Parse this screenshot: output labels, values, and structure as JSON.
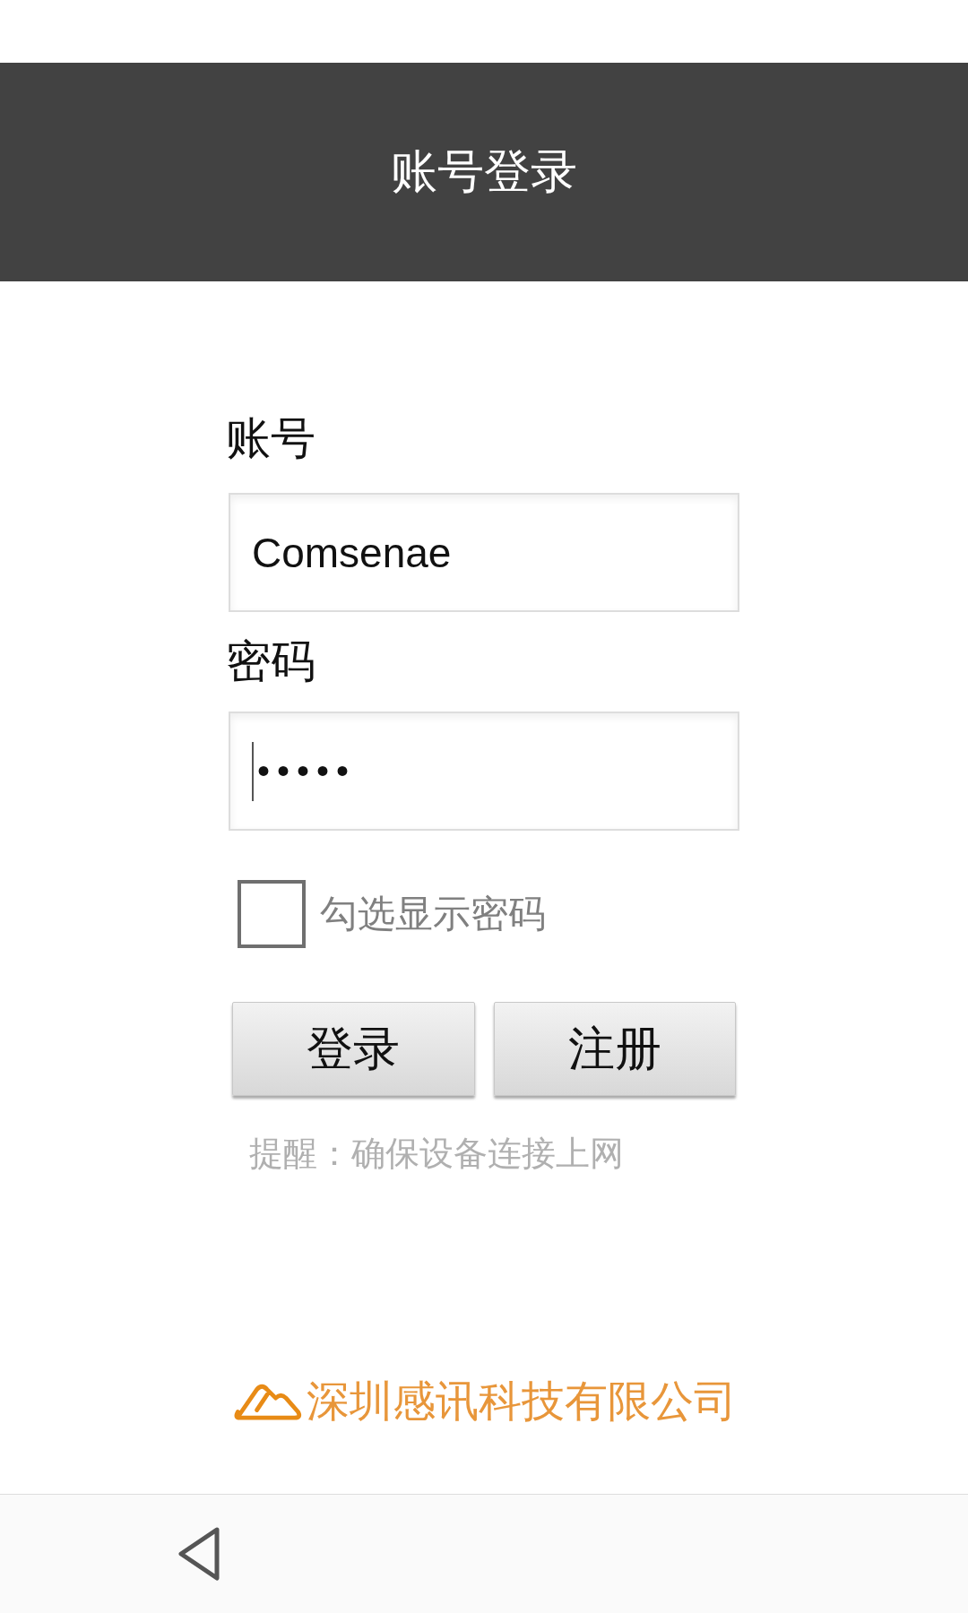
{
  "header": {
    "title": "账号登录"
  },
  "account": {
    "label": "账号",
    "value": "Comsenae"
  },
  "password": {
    "label": "密码",
    "value": "•••••",
    "focused": true
  },
  "show_password": {
    "label": "勾选显示密码",
    "checked": false
  },
  "buttons": [
    {
      "label": "登录"
    },
    {
      "label": "注册"
    }
  ],
  "hint": "提醒：确保设备连接上网",
  "footer": {
    "company": "深圳感讯科技有限公司"
  }
}
